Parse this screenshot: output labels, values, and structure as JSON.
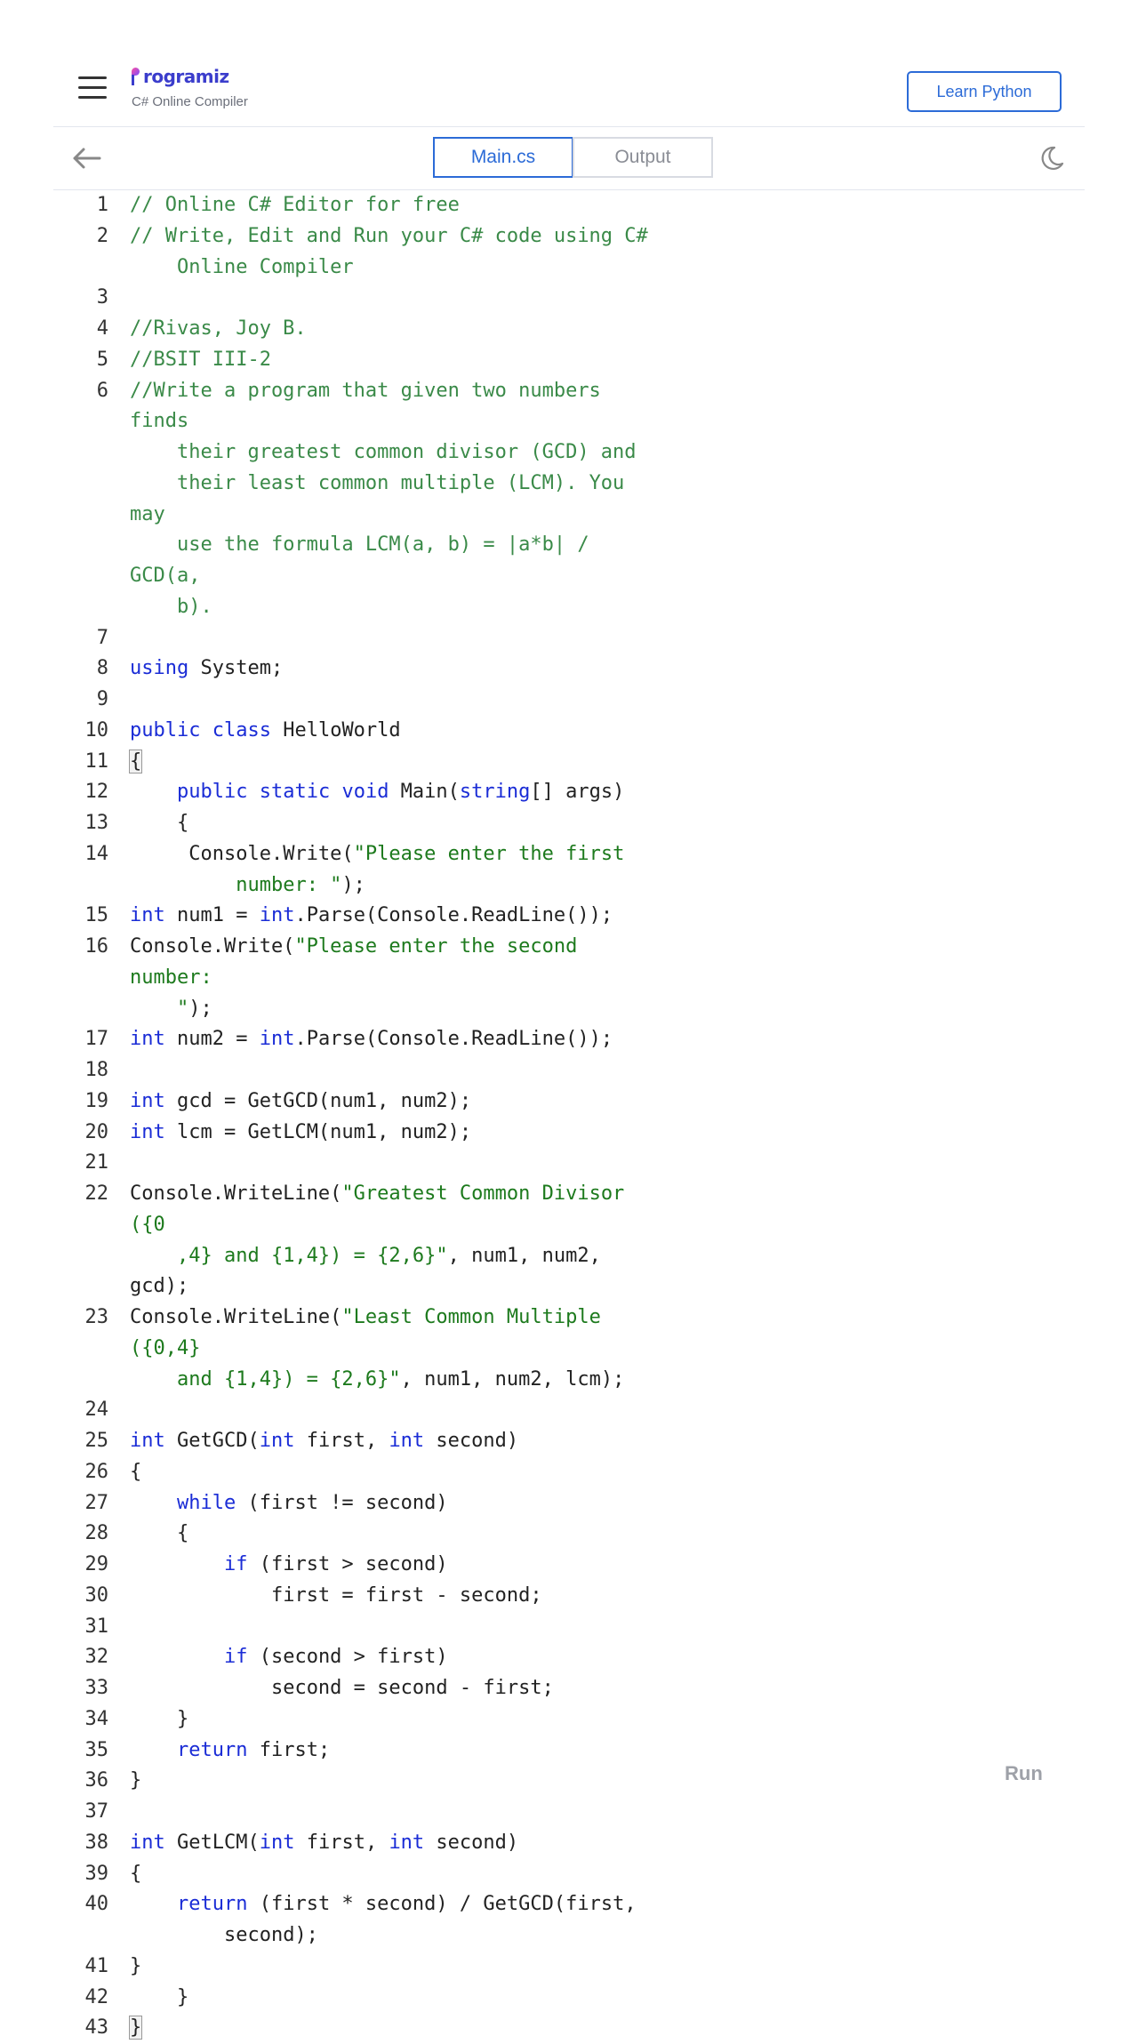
{
  "header": {
    "logo_text": "rogramiz",
    "subtitle": "C# Online Compiler",
    "learn_button": "Learn Python"
  },
  "toolbar": {
    "tabs": [
      {
        "label": "Main.cs",
        "active": true
      },
      {
        "label": "Output",
        "active": false
      }
    ]
  },
  "run_label": "Run",
  "colors": {
    "accent": "#2c6bd7",
    "comment": "#3a8a48",
    "keyword": "#1a2cd6",
    "string": "#1d7a1d"
  },
  "code_lines": [
    {
      "n": "1",
      "tokens": [
        [
          "cmt",
          "// Online C# Editor for free"
        ]
      ]
    },
    {
      "n": "2",
      "tokens": [
        [
          "cmt",
          "// Write, Edit and Run your C# code using C#\n    Online Compiler"
        ]
      ]
    },
    {
      "n": "3",
      "tokens": []
    },
    {
      "n": "4",
      "tokens": [
        [
          "cmt",
          "//Rivas, Joy B."
        ]
      ]
    },
    {
      "n": "5",
      "tokens": [
        [
          "cmt",
          "//BSIT III-2"
        ]
      ]
    },
    {
      "n": "6",
      "tokens": [
        [
          "cmt",
          "//Write a program that given two numbers finds\n    their greatest common divisor (GCD) and\n    their least common multiple (LCM). You may\n    use the formula LCM(a, b) = |a*b| / GCD(a,\n    b)."
        ]
      ]
    },
    {
      "n": "7",
      "tokens": []
    },
    {
      "n": "8",
      "tokens": [
        [
          "kw",
          "using"
        ],
        [
          "",
          " System;"
        ]
      ]
    },
    {
      "n": "9",
      "tokens": []
    },
    {
      "n": "10",
      "tokens": [
        [
          "kw",
          "public"
        ],
        [
          "",
          " "
        ],
        [
          "kw",
          "class"
        ],
        [
          "",
          " HelloWorld"
        ]
      ]
    },
    {
      "n": "11",
      "tokens": [
        [
          "box",
          "{"
        ]
      ]
    },
    {
      "n": "12",
      "tokens": [
        [
          "",
          "    "
        ],
        [
          "kw",
          "public"
        ],
        [
          "",
          " "
        ],
        [
          "kw",
          "static"
        ],
        [
          "",
          " "
        ],
        [
          "kw",
          "void"
        ],
        [
          "",
          " Main("
        ],
        [
          "kw",
          "string"
        ],
        [
          "",
          "[] args)"
        ]
      ]
    },
    {
      "n": "13",
      "tokens": [
        [
          "",
          "    {"
        ]
      ]
    },
    {
      "n": "14",
      "tokens": [
        [
          "",
          "     Console.Write("
        ],
        [
          "str",
          "\"Please enter the first\n         number: \""
        ],
        [
          "",
          ");"
        ]
      ]
    },
    {
      "n": "15",
      "tokens": [
        [
          "kw",
          "int"
        ],
        [
          "",
          " num1 = "
        ],
        [
          "kw",
          "int"
        ],
        [
          "",
          ".Parse(Console.ReadLine());"
        ]
      ]
    },
    {
      "n": "16",
      "tokens": [
        [
          "",
          "Console.Write("
        ],
        [
          "str",
          "\"Please enter the second number:\n    \""
        ],
        [
          "",
          ");"
        ]
      ]
    },
    {
      "n": "17",
      "tokens": [
        [
          "kw",
          "int"
        ],
        [
          "",
          " num2 = "
        ],
        [
          "kw",
          "int"
        ],
        [
          "",
          ".Parse(Console.ReadLine());"
        ]
      ]
    },
    {
      "n": "18",
      "tokens": []
    },
    {
      "n": "19",
      "tokens": [
        [
          "kw",
          "int"
        ],
        [
          "",
          " gcd = GetGCD(num1, num2);"
        ]
      ]
    },
    {
      "n": "20",
      "tokens": [
        [
          "kw",
          "int"
        ],
        [
          "",
          " lcm = GetLCM(num1, num2);"
        ]
      ]
    },
    {
      "n": "21",
      "tokens": []
    },
    {
      "n": "22",
      "tokens": [
        [
          "",
          "Console.WriteLine("
        ],
        [
          "str",
          "\"Greatest Common Divisor ({0\n    ,4} and {1,4}) = {2,6}\""
        ],
        [
          "",
          ", num1, num2, gcd);"
        ]
      ]
    },
    {
      "n": "23",
      "tokens": [
        [
          "",
          "Console.WriteLine("
        ],
        [
          "str",
          "\"Least Common Multiple ({0,4}\n    and {1,4}) = {2,6}\""
        ],
        [
          "",
          ", num1, num2, lcm);"
        ]
      ]
    },
    {
      "n": "24",
      "tokens": []
    },
    {
      "n": "25",
      "tokens": [
        [
          "kw",
          "int"
        ],
        [
          "",
          " GetGCD("
        ],
        [
          "kw",
          "int"
        ],
        [
          "",
          " first, "
        ],
        [
          "kw",
          "int"
        ],
        [
          "",
          " second)"
        ]
      ]
    },
    {
      "n": "26",
      "tokens": [
        [
          "",
          "{"
        ]
      ]
    },
    {
      "n": "27",
      "tokens": [
        [
          "",
          "    "
        ],
        [
          "kw",
          "while"
        ],
        [
          "",
          " (first != second)"
        ]
      ]
    },
    {
      "n": "28",
      "tokens": [
        [
          "",
          "    {"
        ]
      ]
    },
    {
      "n": "29",
      "tokens": [
        [
          "",
          "        "
        ],
        [
          "kw",
          "if"
        ],
        [
          "",
          " (first > second)"
        ]
      ]
    },
    {
      "n": "30",
      "tokens": [
        [
          "",
          "            first = first - second;"
        ]
      ]
    },
    {
      "n": "31",
      "tokens": []
    },
    {
      "n": "32",
      "tokens": [
        [
          "",
          "        "
        ],
        [
          "kw",
          "if"
        ],
        [
          "",
          " (second > first)"
        ]
      ]
    },
    {
      "n": "33",
      "tokens": [
        [
          "",
          "            second = second - first;"
        ]
      ]
    },
    {
      "n": "34",
      "tokens": [
        [
          "",
          "    }"
        ]
      ]
    },
    {
      "n": "35",
      "tokens": [
        [
          "",
          "    "
        ],
        [
          "kw",
          "return"
        ],
        [
          "",
          " first;"
        ]
      ]
    },
    {
      "n": "36",
      "tokens": [
        [
          "",
          "}"
        ]
      ]
    },
    {
      "n": "37",
      "tokens": []
    },
    {
      "n": "38",
      "tokens": [
        [
          "kw",
          "int"
        ],
        [
          "",
          " GetLCM("
        ],
        [
          "kw",
          "int"
        ],
        [
          "",
          " first, "
        ],
        [
          "kw",
          "int"
        ],
        [
          "",
          " second)"
        ]
      ]
    },
    {
      "n": "39",
      "tokens": [
        [
          "",
          "{"
        ]
      ]
    },
    {
      "n": "40",
      "tokens": [
        [
          "",
          "    "
        ],
        [
          "kw",
          "return"
        ],
        [
          "",
          " (first * second) / GetGCD(first,\n        second);"
        ]
      ]
    },
    {
      "n": "41",
      "tokens": [
        [
          "",
          "}"
        ]
      ]
    },
    {
      "n": "42",
      "tokens": [
        [
          "",
          "    }"
        ]
      ]
    },
    {
      "n": "43",
      "tokens": [
        [
          "box",
          "}"
        ]
      ]
    }
  ]
}
